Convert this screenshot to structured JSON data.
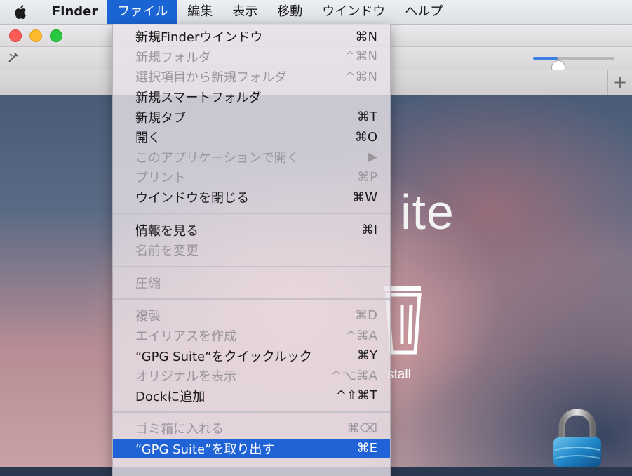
{
  "menubar": {
    "apple_icon": "apple-icon",
    "items": [
      "Finder",
      "ファイル",
      "編集",
      "表示",
      "移動",
      "ウインドウ",
      "ヘルプ"
    ]
  },
  "window": {
    "big_title_fragment": "ite",
    "uninstall_fragment": "stall",
    "zoom_slider_level": 0.3,
    "tab_add": "+"
  },
  "file_menu": {
    "groups": [
      [
        {
          "label": "新規Finderウインドウ",
          "shortcut": "⌘N",
          "enabled": true
        },
        {
          "label": "新規フォルダ",
          "shortcut": "⇧⌘N",
          "enabled": false
        },
        {
          "label": "選択項目から新規フォルダ",
          "shortcut": "^⌘N",
          "enabled": false
        },
        {
          "label": "新規スマートフォルダ",
          "shortcut": "",
          "enabled": true
        },
        {
          "label": "新規タブ",
          "shortcut": "⌘T",
          "enabled": true
        },
        {
          "label": "開く",
          "shortcut": "⌘O",
          "enabled": true
        },
        {
          "label": "このアプリケーションで開く",
          "shortcut": "▶",
          "enabled": false
        },
        {
          "label": "プリント",
          "shortcut": "⌘P",
          "enabled": false
        },
        {
          "label": "ウインドウを閉じる",
          "shortcut": "⌘W",
          "enabled": true
        }
      ],
      [
        {
          "label": "情報を見る",
          "shortcut": "⌘I",
          "enabled": true
        },
        {
          "label": "名前を変更",
          "shortcut": "",
          "enabled": false
        }
      ],
      [
        {
          "label": "圧縮",
          "shortcut": "",
          "enabled": false
        }
      ],
      [
        {
          "label": "複製",
          "shortcut": "⌘D",
          "enabled": false
        },
        {
          "label": "エイリアスを作成",
          "shortcut": "^⌘A",
          "enabled": false
        },
        {
          "label": "“GPG Suite”をクイックルック",
          "shortcut": "⌘Y",
          "enabled": true
        },
        {
          "label": "オリジナルを表示",
          "shortcut": "^⌥⌘A",
          "enabled": false
        },
        {
          "label": "Dockに追加",
          "shortcut": "^⇧⌘T",
          "enabled": true
        }
      ],
      [
        {
          "label": "ゴミ箱に入れる",
          "shortcut": "⌘⌫",
          "enabled": false
        },
        {
          "label": "“GPG Suite”を取り出す",
          "shortcut": "⌘E",
          "enabled": true,
          "highlighted": true
        }
      ]
    ]
  },
  "colors": {
    "menu_highlight": "#1f63d6",
    "menubar_active": "#1a64d4"
  }
}
